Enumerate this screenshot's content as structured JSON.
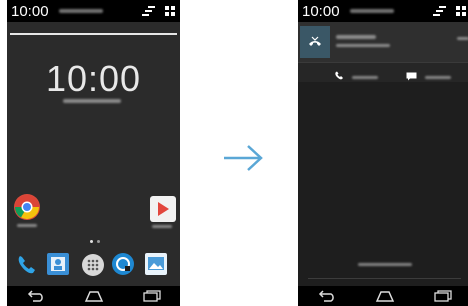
{
  "left_screen": {
    "status_time": "10:00",
    "clock": "10:00"
  },
  "right_screen": {
    "status_time": "10:00"
  },
  "colors": {
    "arrow": "#5aa7d6",
    "notification_tile": "#3a5766",
    "phone_background": "#2b2b2b"
  },
  "icons": {
    "left_status": [
      "signal-icon",
      "grid-icon"
    ],
    "left_home": [
      "chrome-icon",
      "play-store-icon"
    ],
    "left_dock": [
      "phone-icon",
      "contacts-icon",
      "apps-icon",
      "browser-icon",
      "gallery-icon"
    ],
    "nav": [
      "back-icon",
      "home-icon",
      "recents-icon"
    ],
    "notification": [
      "missed-call-icon",
      "call-back-icon",
      "message-icon"
    ],
    "transition": "arrow-right-icon"
  }
}
